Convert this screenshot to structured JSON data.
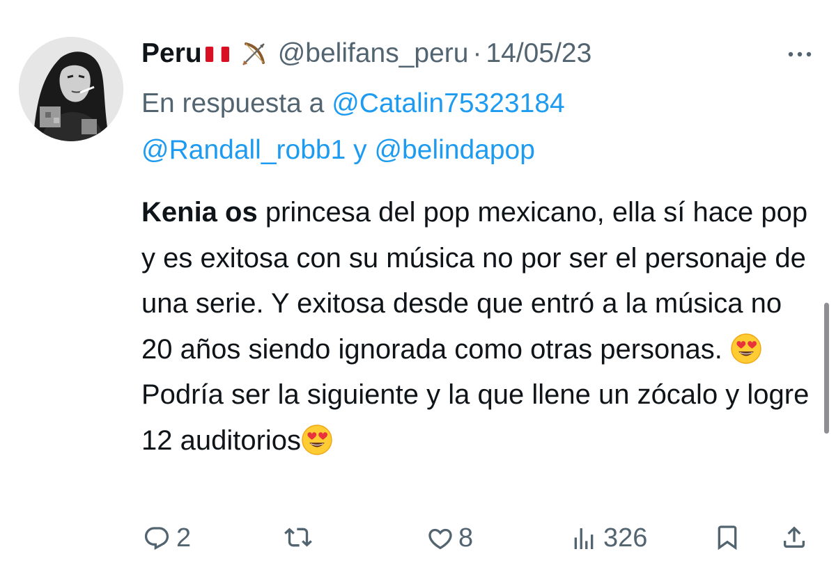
{
  "tweet": {
    "display_name": "Peru",
    "flag_icon": "peru-flag-icon",
    "badge_icon": "bow-and-arrow-icon",
    "handle": "@belifans_peru",
    "separator": "·",
    "date": "14/05/23",
    "more_icon": "more-horizontal-icon",
    "reply_prefix": "En respuesta a",
    "reply_mention_1": "@Catalin75323184",
    "reply_mention_2": "@Randall_robb1",
    "reply_conjunction": "y",
    "reply_mention_3": "@belindapop",
    "body_bold": "Kenia os",
    "body_part1": " princesa del pop mexicano, ella sí hace pop y es exitosa con su música no por ser el personaje de una serie. Y exitosa desde que entró a la música no 20 años siendo ignorada como otras personas. ",
    "body_part2": "Podría ser la siguiente y la que llene un zócalo y logre 12 auditorios",
    "emoji_icon": "heart-eyes-emoji-icon"
  },
  "actions": {
    "replies": "2",
    "retweets": "",
    "likes": "8",
    "views": "326",
    "reply_icon": "reply-icon",
    "retweet_icon": "retweet-icon",
    "like_icon": "heart-icon",
    "views_icon": "views-icon",
    "bookmark_icon": "bookmark-icon",
    "share_icon": "share-icon"
  },
  "colors": {
    "text": "#0f1419",
    "secondary": "#536471",
    "link": "#1d9bf0",
    "flag_red": "#d91023"
  }
}
